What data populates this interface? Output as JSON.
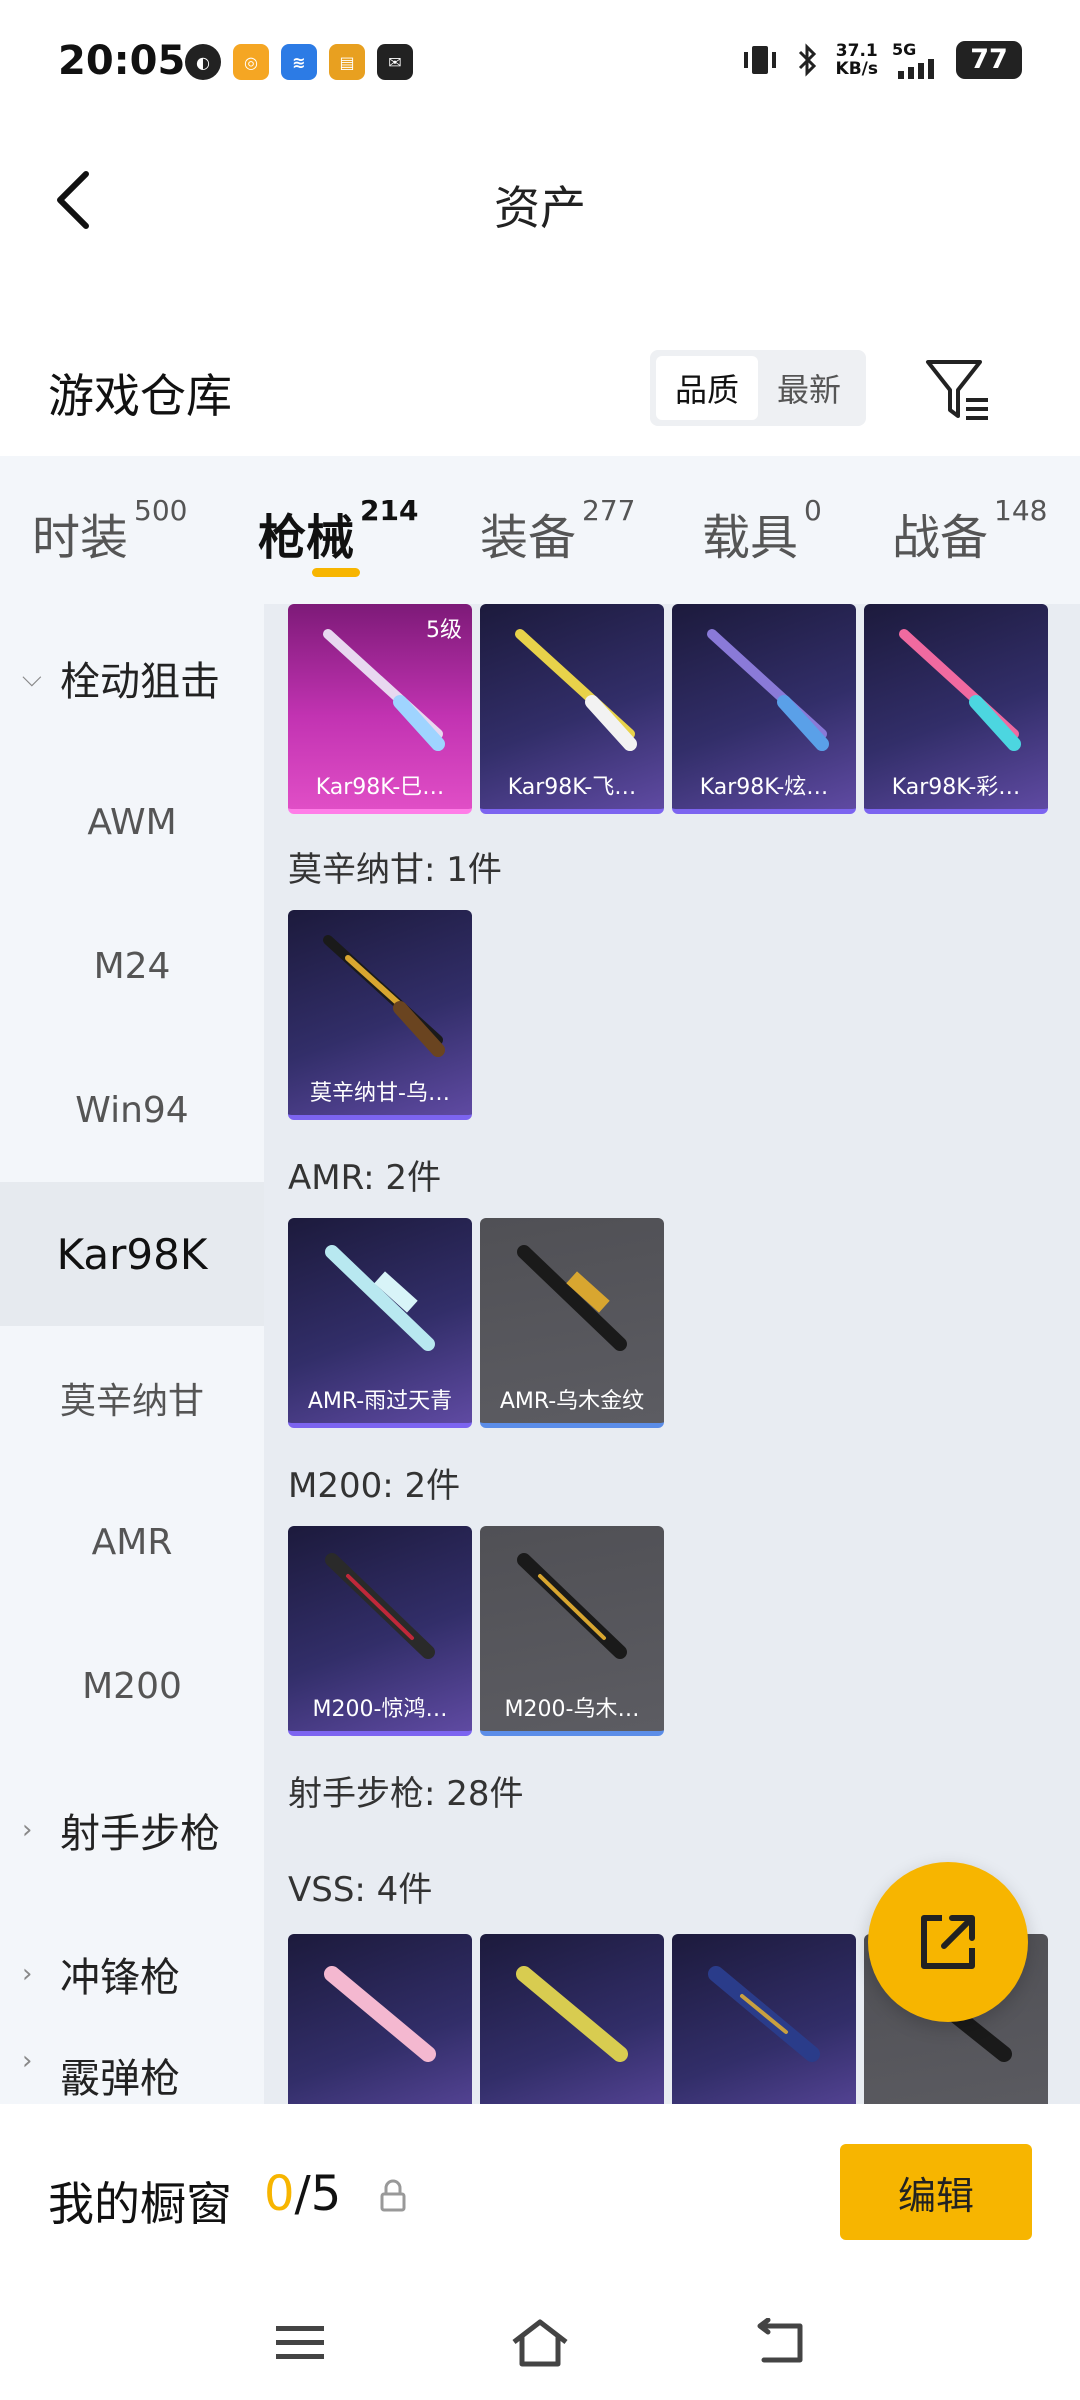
{
  "status_bar": {
    "time": "20:05",
    "net_speed_value": "37.1",
    "net_speed_unit": "KB/s",
    "network": "5G",
    "battery": "77"
  },
  "header": {
    "title": "资产"
  },
  "warehouse": {
    "title": "游戏仓库",
    "sort_options": [
      "品质",
      "最新"
    ],
    "active_sort": "品质"
  },
  "tabs": [
    {
      "label": "时装",
      "count": "500"
    },
    {
      "label": "枪械",
      "count": "214",
      "active": true
    },
    {
      "label": "装备",
      "count": "277"
    },
    {
      "label": "载具",
      "count": "0"
    },
    {
      "label": "战备",
      "count": "148"
    }
  ],
  "sidebar": {
    "category_open": "栓动狙击",
    "sub_items": [
      "AWM",
      "M24",
      "Win94",
      "Kar98K",
      "莫辛纳甘",
      "AMR",
      "M200"
    ],
    "active": "Kar98K",
    "categories_closed": [
      "射手步枪",
      "冲锋枪",
      "霰弹枪"
    ]
  },
  "content": {
    "kar98k_items": [
      {
        "name": "Kar98K-巳…",
        "level": "5级",
        "style": "pink"
      },
      {
        "name": "Kar98K-飞…",
        "style": "purple"
      },
      {
        "name": "Kar98K-炫…",
        "style": "purple"
      },
      {
        "name": "Kar98K-彩…",
        "style": "purple"
      }
    ],
    "groups": [
      {
        "label": "莫辛纳甘: 1件",
        "items": [
          {
            "name": "莫辛纳甘-乌…",
            "style": "purple"
          }
        ]
      },
      {
        "label": "AMR: 2件",
        "items": [
          {
            "name": "AMR-雨过天青",
            "style": "purple"
          },
          {
            "name": "AMR-乌木金纹",
            "style": "gray"
          }
        ]
      },
      {
        "label": "M200: 2件",
        "items": [
          {
            "name": "M200-惊鸿…",
            "style": "purple"
          },
          {
            "name": "M200-乌木…",
            "style": "gray"
          }
        ]
      }
    ],
    "category_summary": "射手步枪: 28件",
    "vss_label": "VSS: 4件"
  },
  "bottom_bar": {
    "window_label": "我的橱窗",
    "window_current": "0",
    "window_total": "/5",
    "edit_label": "编辑"
  },
  "colors": {
    "accent": "#f7b500",
    "card_purple": "#322e69",
    "card_pink": "#c233b2",
    "card_gray": "#5c5c62"
  },
  "icons": [
    "back-arrow-icon",
    "filter-icon",
    "share-icon",
    "lock-icon",
    "menu-icon",
    "home-icon",
    "back-nav-icon"
  ]
}
